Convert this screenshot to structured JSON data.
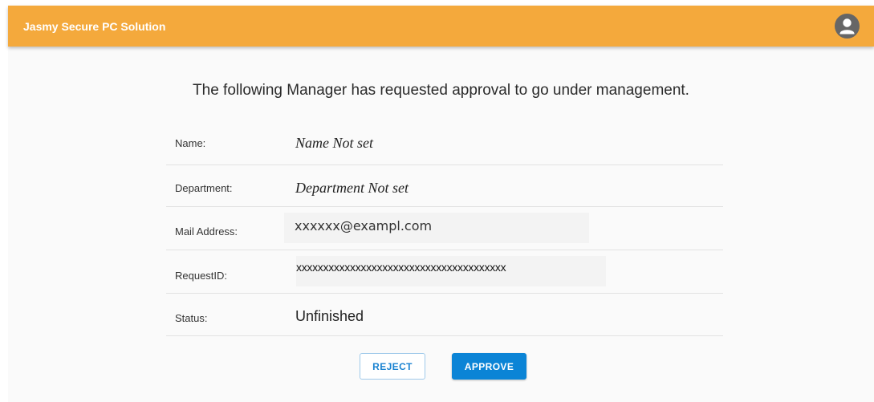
{
  "app": {
    "title": "Jasmy Secure PC Solution",
    "accent_color": "#f4a93c",
    "avatar_icon": "account-circle-icon"
  },
  "main": {
    "heading": "The following Manager has requested approval to go under management.",
    "fields": {
      "name": {
        "label": "Name:",
        "value": "Name Not set"
      },
      "department": {
        "label": "Department:",
        "value": "Department Not set"
      },
      "mail": {
        "label": "Mail Address:",
        "value": "xxxxxx@exampl.com"
      },
      "request_id": {
        "label": "RequestID:",
        "value": "xxxxxxxxxxxxxxxxxxxxxxxxxxxxxxxxxxxxxxx"
      },
      "status": {
        "label": "Status:",
        "value": "Unfinished"
      }
    }
  },
  "actions": {
    "reject_label": "REJECT",
    "approve_label": "APPROVE",
    "approve_color": "#0b84d6"
  }
}
